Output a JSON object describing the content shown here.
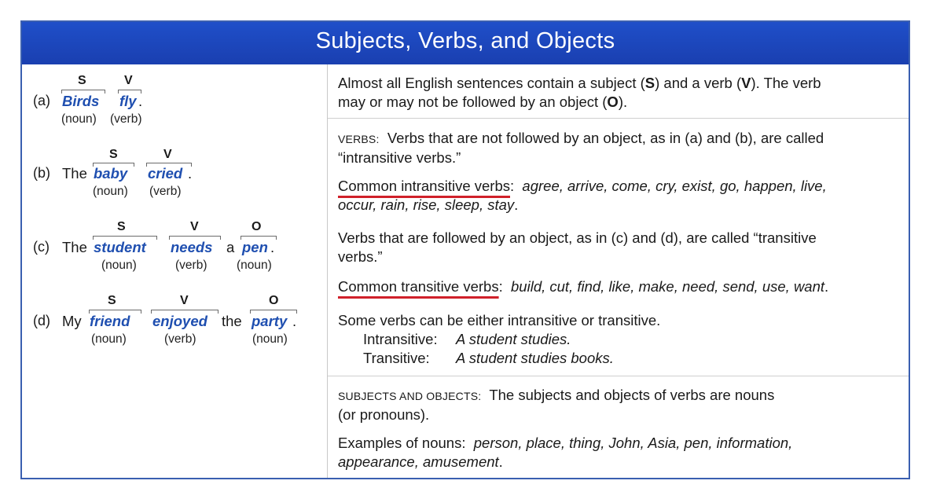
{
  "title": "Subjects, Verbs, and Objects",
  "examples": [
    {
      "label": "(a)",
      "pre": "",
      "subject": "Birds",
      "verb": "fly",
      "mid": "",
      "object": "",
      "end": ".",
      "s_tag": "S",
      "v_tag": "V",
      "o_tag": "",
      "noun": "(noun)",
      "verb_word": "(verb)",
      "obj_noun": ""
    },
    {
      "label": "(b)",
      "pre": "The",
      "subject": "baby",
      "verb": "cried",
      "mid": "",
      "object": "",
      "end": ".",
      "s_tag": "S",
      "v_tag": "V",
      "o_tag": "",
      "noun": "(noun)",
      "verb_word": "(verb)",
      "obj_noun": ""
    },
    {
      "label": "(c)",
      "pre": "The",
      "subject": "student",
      "verb": "needs",
      "mid": "a",
      "object": "pen",
      "end": ".",
      "s_tag": "S",
      "v_tag": "V",
      "o_tag": "O",
      "noun": "(noun)",
      "verb_word": "(verb)",
      "obj_noun": "(noun)"
    },
    {
      "label": "(d)",
      "pre": "My",
      "subject": "friend",
      "verb": "enjoyed",
      "mid": "the",
      "object": "party",
      "end": ".",
      "s_tag": "S",
      "v_tag": "V",
      "o_tag": "O",
      "noun": "(noun)",
      "verb_word": "(verb)",
      "obj_noun": "(noun)"
    }
  ],
  "right": {
    "intro_1": "Almost all English sentences contain a subject (",
    "intro_s": "S",
    "intro_2": ") and a verb (",
    "intro_v": "V",
    "intro_3": ").  The verb",
    "intro_4": "may or may not be followed by an object (",
    "intro_o": "O",
    "intro_5": ").",
    "verbs_heading": "VERBS:",
    "verbs_text_1": "Verbs that are not followed by an object, as in (a) and (b), are called",
    "verbs_text_2": "“intransitive verbs.”",
    "intrans_label": "Common intransitive verbs",
    "intrans_colon": ":",
    "intrans_list_1": "agree, arrive, come, cry, exist, go, happen, live,",
    "intrans_list_2": "occur, rain, rise, sleep, stay",
    "intrans_end": ".",
    "trans_text_1": "Verbs that are followed by an object, as in (c) and (d), are called “transitive",
    "trans_text_2": "verbs.”",
    "trans_label": "Common transitive verbs",
    "trans_colon": ":",
    "trans_list": "build, cut, find, like, make, need, send, use, want",
    "trans_end": ".",
    "either_text": "Some verbs can be either intransitive or transitive.",
    "intrans_example_label": "Intransitive:",
    "intrans_example": "A student studies.",
    "trans_example_label": "Transitive:",
    "trans_example": "A student studies books.",
    "so_heading": "SUBJECTS AND OBJECTS:",
    "so_text_1": "The subjects and objects of verbs are nouns",
    "so_text_2": "(or pronouns).",
    "nouns_label": "Examples of nouns:",
    "nouns_list_1": "person, place, thing, John, Asia, pen, information,",
    "nouns_list_2": "appearance, amusement",
    "nouns_end": "."
  },
  "colors": {
    "header_blue": "#1f4fc9",
    "word_blue": "#1f4fb0",
    "underline_red": "#d0202a",
    "frame": "#3a5fb0"
  }
}
